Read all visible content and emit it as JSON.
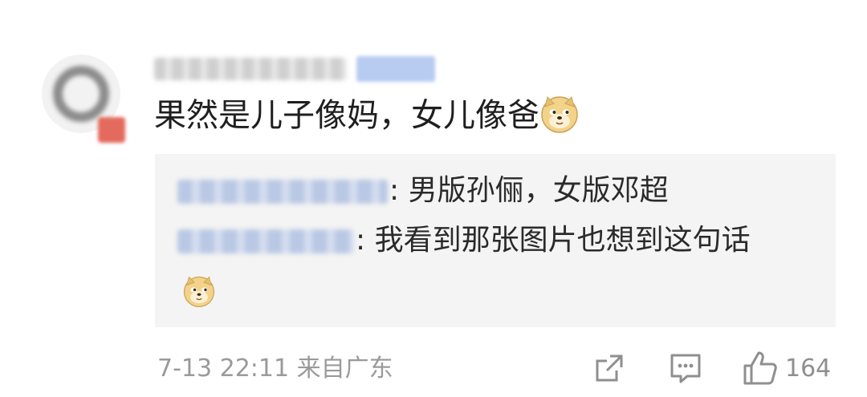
{
  "comment": {
    "author_name": "",
    "text": "果然是儿子像妈，女儿像爸",
    "emoji": "doge-emoji"
  },
  "replies": [
    {
      "text": ": 男版孙俪，女版邓超"
    },
    {
      "text": ": 我看到那张图片也想到这句话",
      "emoji": "doge-emoji"
    }
  ],
  "meta": {
    "time": "7-13 22:11",
    "location": "来自广东"
  },
  "actions": {
    "share_icon": "share-icon",
    "reply_icon": "comment-icon",
    "like_icon": "thumbs-up-icon",
    "like_count": "164"
  },
  "colors": {
    "text": "#1f1f1f",
    "meta": "#9a9a9a",
    "reply_bg": "#f4f4f4",
    "icon": "#8f8f8f"
  }
}
